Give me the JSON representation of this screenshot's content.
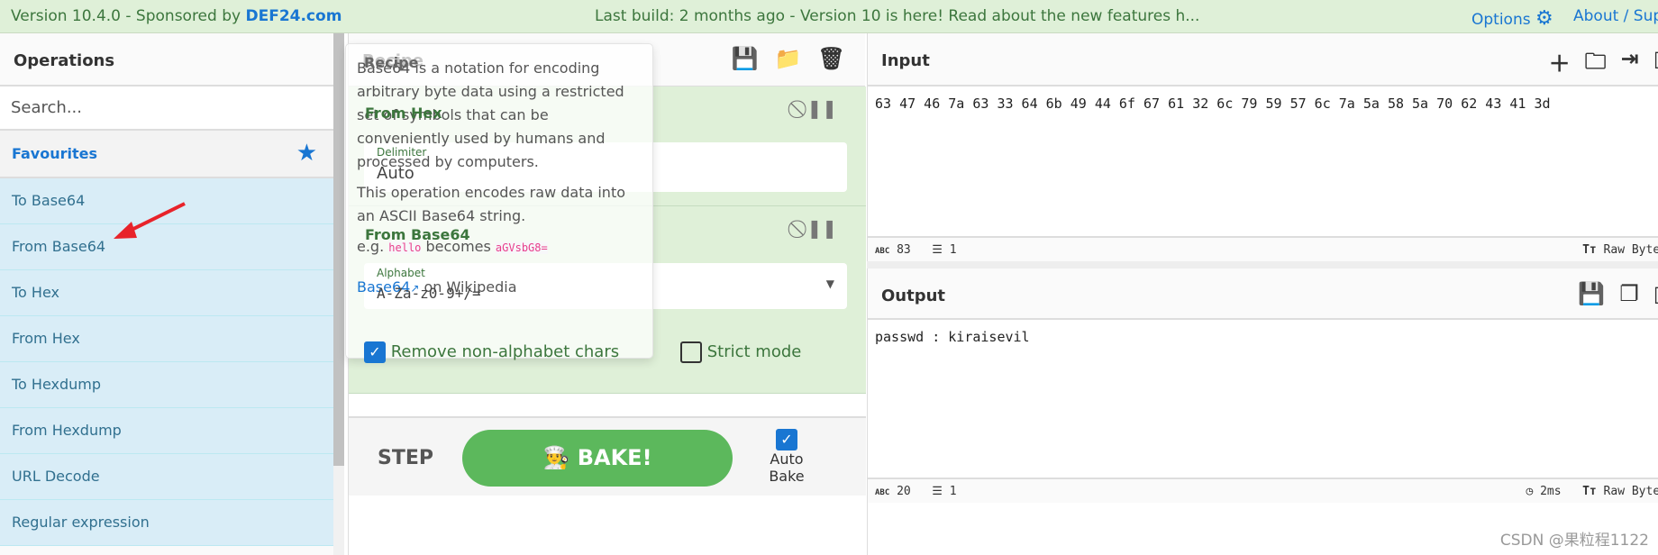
{
  "banner": {
    "version": "Version 10.4.0 - Sponsored by ",
    "sponsor": "DEF24.com",
    "notice": "Last build: 2 months ago - Version 10 is here! Read about the new features h...",
    "options": "Options",
    "about": "About / Sup"
  },
  "operations": {
    "title": "Operations",
    "search_placeholder": "Search...",
    "favourites": "Favourites",
    "items": [
      "To Base64",
      "From Base64",
      "To Hex",
      "From Hex",
      "To Hexdump",
      "From Hexdump",
      "URL Decode",
      "Regular expression"
    ]
  },
  "recipe": {
    "title": "Recipe",
    "ops": [
      {
        "name": "From Hex",
        "field_label": "Delimiter",
        "field_value": "Auto"
      },
      {
        "name": "From Base64",
        "field_label": "Alphabet",
        "field_value": "A-Za-z0-9+/=",
        "remove_label": "Remove non-alphabet chars",
        "remove_checked": true,
        "strict_label": "Strict mode",
        "strict_checked": false
      }
    ],
    "step": "STEP",
    "bake": "BAKE!",
    "auto_bake": "Auto Bake",
    "auto_bake_checked": true
  },
  "tooltip": {
    "p1": "Base64 is a notation for encoding arbitrary byte data using a restricted set of symbols that can be conveniently used by humans and processed by computers.",
    "p2": "This operation encodes raw data into an ASCII Base64 string.",
    "eg_prefix": "e.g. ",
    "eg_in": "hello",
    "eg_mid": " becomes ",
    "eg_out": "aGVsbG8=",
    "link": "Base64",
    "link_suffix": " on Wikipedia"
  },
  "input": {
    "title": "Input",
    "value": "63 47 46 7a 63 33 64 6b 49 44 6f 67 61 32 6c 79 59 57 6c 7a 5a 58 5a 70 62 43 41 3d",
    "chars": "83",
    "lines": "1",
    "encoding": "Raw Bytes"
  },
  "output": {
    "title": "Output",
    "value": "passwd : kiraisevil",
    "chars": "20",
    "lines": "1",
    "time": "2ms",
    "encoding": "Raw Bytes"
  },
  "watermark": "CSDN @果粒程1122",
  "colors": {
    "banner": "#dff0d8",
    "accent": "#1976d2",
    "op_bg": "#d9edf7",
    "recipe_op": "#dff0d8",
    "bake": "#5cb85c",
    "arrow": "#e8232a"
  }
}
